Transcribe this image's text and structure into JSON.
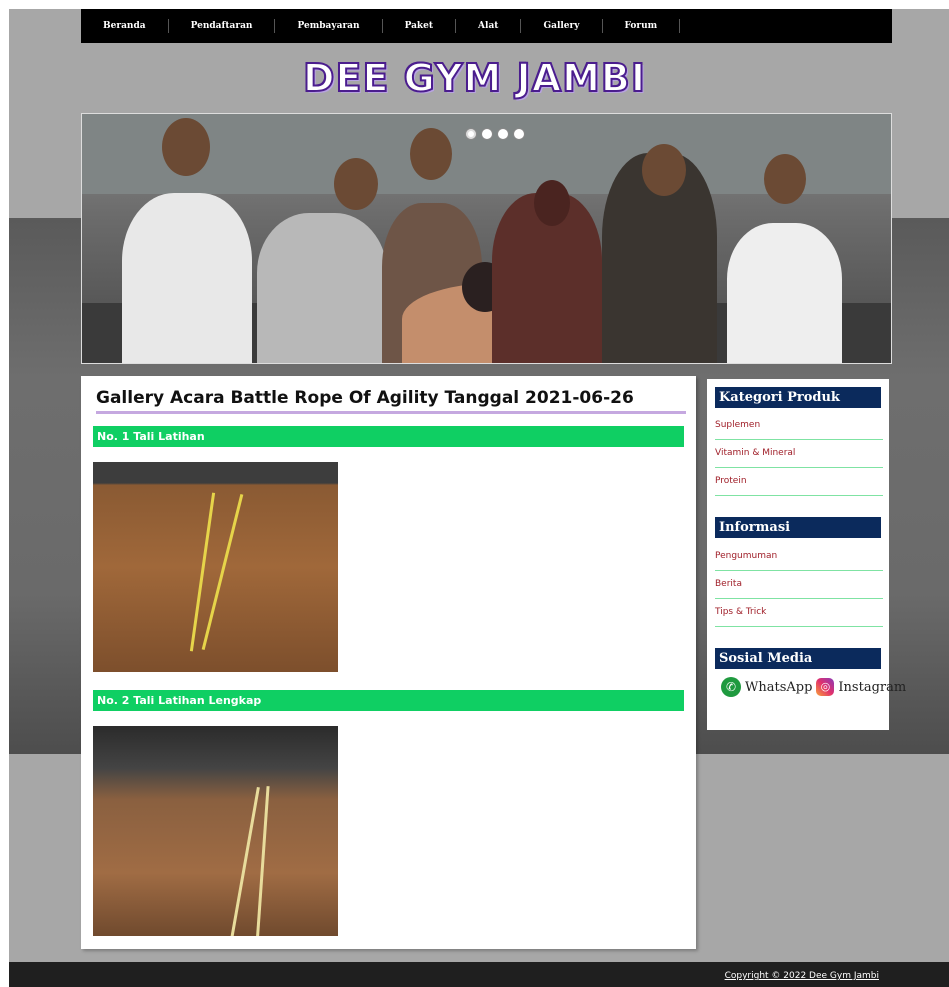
{
  "nav": {
    "items": [
      "Beranda",
      "Pendaftaran",
      "Pembayaran",
      "Paket",
      "Alat",
      "Gallery",
      "Forum"
    ]
  },
  "brand": {
    "title": "DEE GYM JAMBI"
  },
  "hero": {
    "slides": 4,
    "active_slide": 1
  },
  "main": {
    "title": "Gallery Acara Battle Rope Of Agility Tanggal 2021-06-26",
    "sections": [
      {
        "label": "No. 1 Tali Latihan"
      },
      {
        "label": "No. 2 Tali Latihan Lengkap"
      }
    ]
  },
  "sidebar": {
    "kategori_title": "Kategori Produk",
    "kategori_items": [
      "Suplemen",
      "Vitamin & Mineral",
      "Protein"
    ],
    "informasi_title": "Informasi",
    "informasi_items": [
      "Pengumuman",
      "Berita",
      "Tips & Trick"
    ],
    "sosmed_title": "Sosial Media",
    "whatsapp": "WhatsApp",
    "instagram": "Instagram"
  },
  "footer": {
    "copyright": "Copyright © 2022 Dee Gym Jambi"
  },
  "colors": {
    "section_bar": "#0fcf63",
    "sidebar_head": "#0b2a5c",
    "link": "#a0202a",
    "title_underline": "#c5a8e0",
    "brand_stroke": "#4b1d8e"
  }
}
